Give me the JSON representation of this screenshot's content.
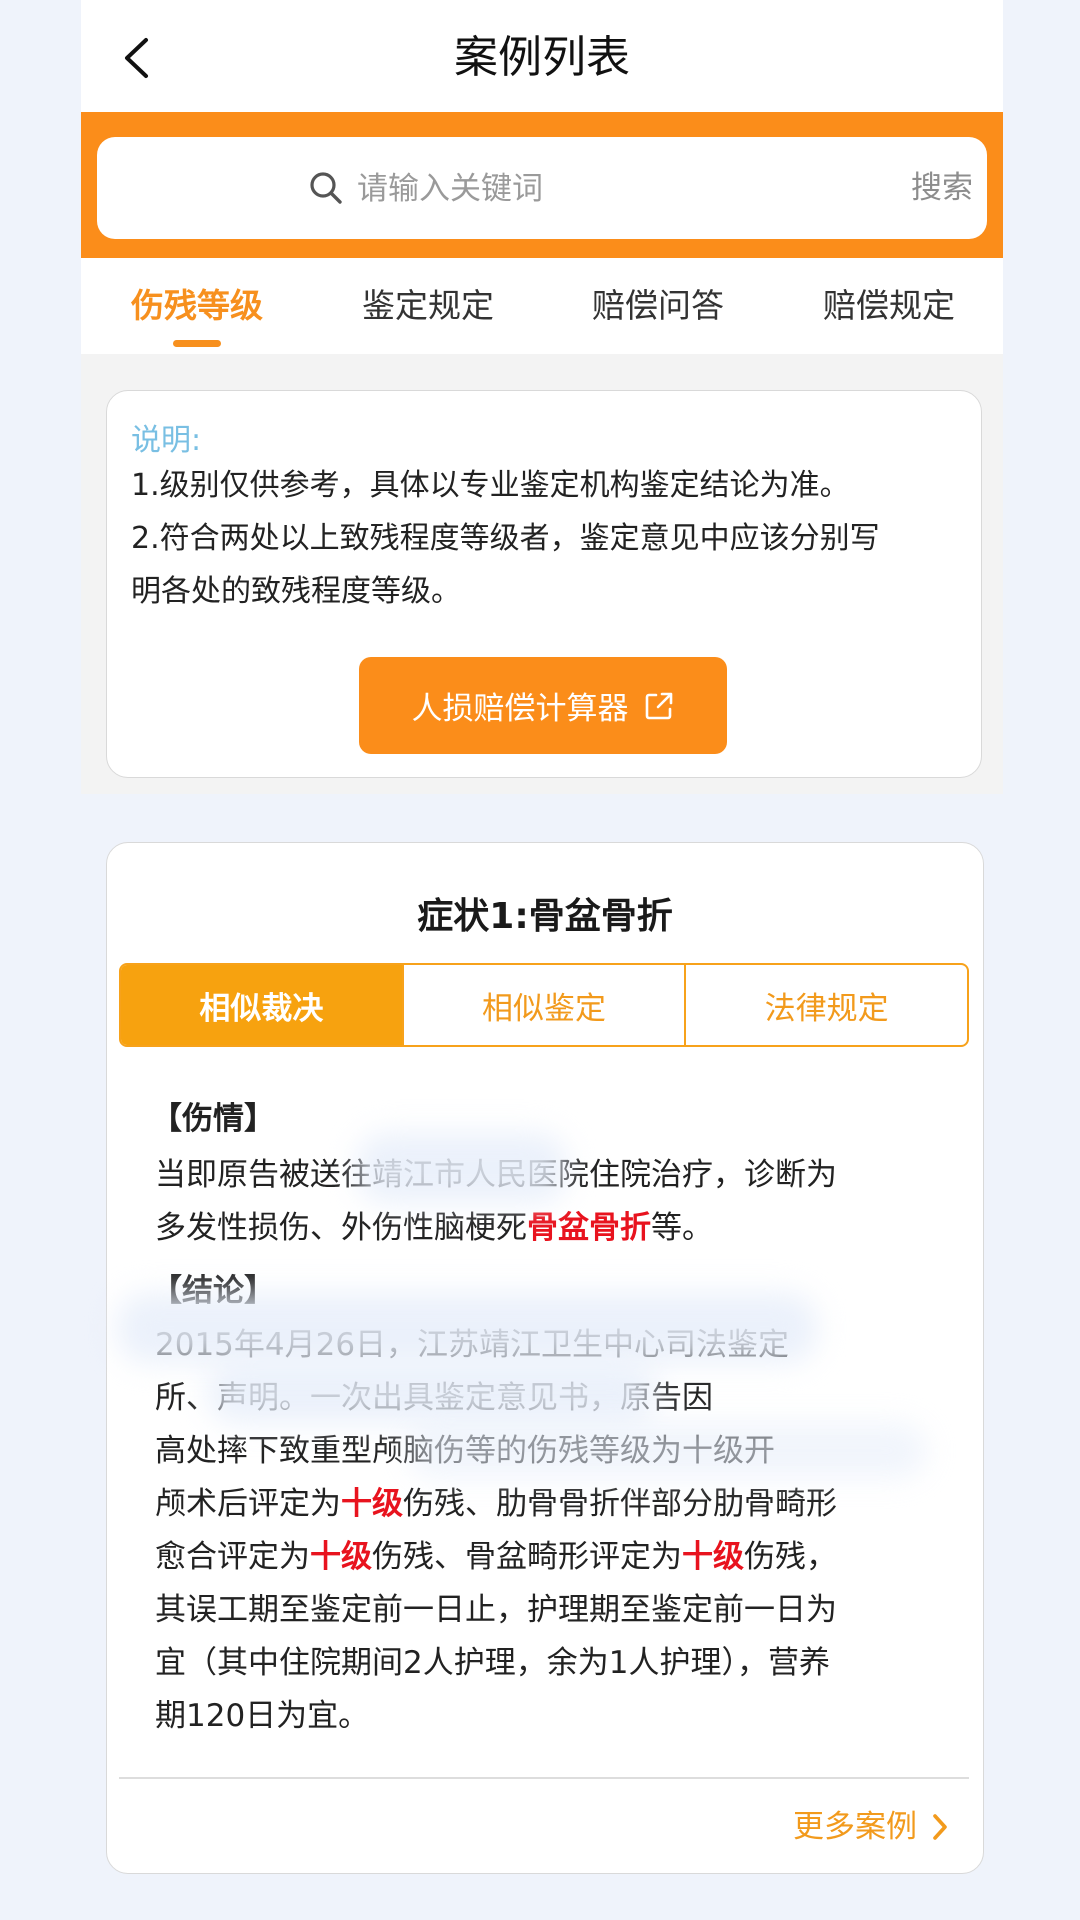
{
  "header": {
    "title": "案例列表"
  },
  "search": {
    "placeholder": "请输入关键词",
    "button": "搜索"
  },
  "tabs": [
    {
      "label": "伤残等级",
      "active": true
    },
    {
      "label": "鉴定规定",
      "active": false
    },
    {
      "label": "赔偿问答",
      "active": false
    },
    {
      "label": "赔偿规定",
      "active": false
    }
  ],
  "notice": {
    "title": "说明:",
    "line1": "1.级别仅供参考，具体以专业鉴定机构鉴定结论为准。",
    "line2a": "2.符合两处以上致残程度等级者，鉴定意见中应该分别写",
    "line2b": "明各处的致残程度等级。",
    "button": "人损赔偿计算器"
  },
  "case": {
    "title": "症状1:骨盆骨折",
    "segments": [
      {
        "label": "相似裁决",
        "active": true
      },
      {
        "label": "相似鉴定",
        "active": false
      },
      {
        "label": "法律规定",
        "active": false
      }
    ],
    "injury_head": "【伤情】",
    "injury_line1": "当即原告被送往靖江市人民医院住院治疗，诊断为",
    "injury_line2_pre": "多发性损伤、外伤性脑梗死",
    "injury_line2_hl": "骨盆骨折",
    "injury_line2_post": "等。",
    "conclusion_head": "【结论】",
    "c1": "2015年4月26日，江苏靖江卫生中心司法鉴定",
    "c2": "所、声明。一次出具鉴定意见书，原告因",
    "c3": "高处摔下致重型颅脑伤等的伤残等级为十级开",
    "c4_pre": "颅术后评定为",
    "c4_hl": "十级",
    "c4_post": "伤残、肋骨骨折伴部分肋骨畸形",
    "c5_pre": "愈合评定为",
    "c5_hl1": "十级",
    "c5_mid": "伤残、骨盆畸形评定为",
    "c5_hl2": "十级",
    "c5_post": "伤残，",
    "c6": "其误工期至鉴定前一日止，护理期至鉴定前一日为",
    "c7": "宜（其中住院期间2人护理，余为1人护理），营养",
    "c8": "期120日为宜。",
    "more": "更多案例"
  },
  "colors": {
    "accent": "#fb8d1a",
    "highlight": "#e8131e",
    "note_title": "#79bfe3"
  }
}
